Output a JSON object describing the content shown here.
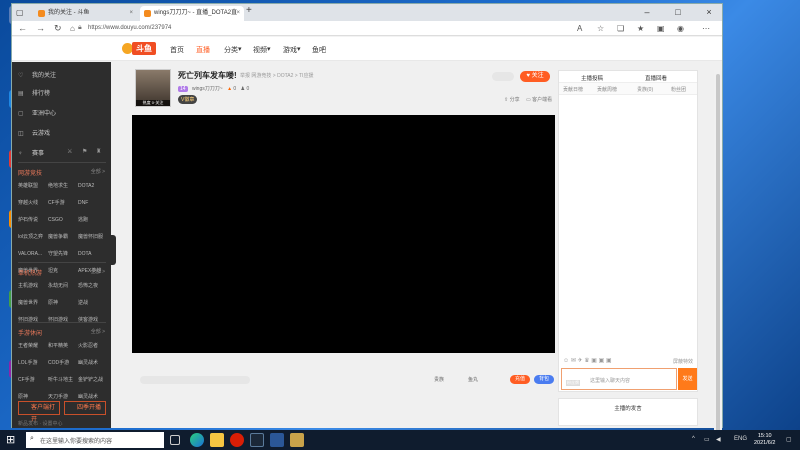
{
  "browser": {
    "tabs": [
      {
        "label": "我的关注 - 斗鱼"
      },
      {
        "label": "wings刀刀刀~ - 直播_DOTA2直"
      }
    ],
    "url": "https://www.douyu.com/237974"
  },
  "site": {
    "logo": "斗鱼",
    "nav": [
      "首页",
      "直播",
      "分类",
      "视频",
      "游戏",
      "鱼吧"
    ]
  },
  "sidebar": {
    "top_items": [
      {
        "label": "我的关注",
        "icon": "heart-icon"
      },
      {
        "label": "排行榜",
        "icon": "rank-icon"
      },
      {
        "label": "亚洲中心",
        "icon": "center-icon"
      },
      {
        "label": "云游戏",
        "icon": "gamepad-icon"
      },
      {
        "label": "赛事",
        "icon": "trophy-icon"
      }
    ],
    "sections": [
      {
        "title": "网游竞技",
        "more": "全部 >",
        "items": [
          "英雄联盟",
          "绝地求生",
          "DOTA2",
          "穿越火线",
          "CF手游",
          "DNF",
          "炉石传说",
          "CSGO",
          "逃跑",
          "lol云顶之弈",
          "魔兽争霸",
          "魔兽怀旧服",
          "VALORA...",
          "守望先锋",
          "DOTA",
          "魔兽世界",
          "坦克",
          "APEX英雄"
        ]
      },
      {
        "title": "单机热游",
        "more": "全部 >",
        "items": [
          "主机游戏",
          "永劫无间",
          "恐怖之夜",
          "魔兽世界",
          "原神",
          "逆战",
          "怀旧游戏",
          "怀旧游戏",
          "侠客游戏"
        ]
      },
      {
        "title": "手游休闲",
        "more": "全部 >",
        "items": [
          "王者荣耀",
          "和平精英",
          "火影忍者",
          "LOL手游",
          "COD手游",
          "幽灵战术",
          "CF手游",
          "听牛斗地主",
          "金铲铲之战",
          "原神",
          "天刀手游",
          "幽灵战术"
        ]
      }
    ],
    "buttons": [
      "客户端打开",
      "四季开播"
    ],
    "footer": "新品发布  ·  设置中心"
  },
  "room": {
    "title": "死亡列车发车喽!",
    "meta": "举报   网游竞技 > DOTA2 > TI应援",
    "anchor": "wings刀刀刀~",
    "level": "14",
    "hot": "0",
    "fans": "0",
    "vip_label": "V徽章",
    "avatar_badge": "热度  0·关注",
    "actions": [
      "分享",
      "客户端看"
    ]
  },
  "player_bar": {
    "hint": "",
    "fullscreen": "贵族",
    "yuwan": "鱼丸",
    "charge": "充值",
    "gift": "背包"
  },
  "chat": {
    "tabs": [
      "主播投稿",
      "直播回看"
    ],
    "rank_tabs": [
      "贡献日榜",
      "贡献周榜",
      "贵族(0)",
      "粉丝团"
    ],
    "input_placeholder": "这里输入聊天内容",
    "send": "发送",
    "fan_tag": "粉丝牌",
    "right_tool": "屏蔽特效",
    "anchor_dynamic": "主播的发言"
  },
  "taskbar": {
    "search": "在这里输入你要搜索的内容",
    "lang": "ENG",
    "time": "15:10",
    "date": "2021/6/2"
  }
}
